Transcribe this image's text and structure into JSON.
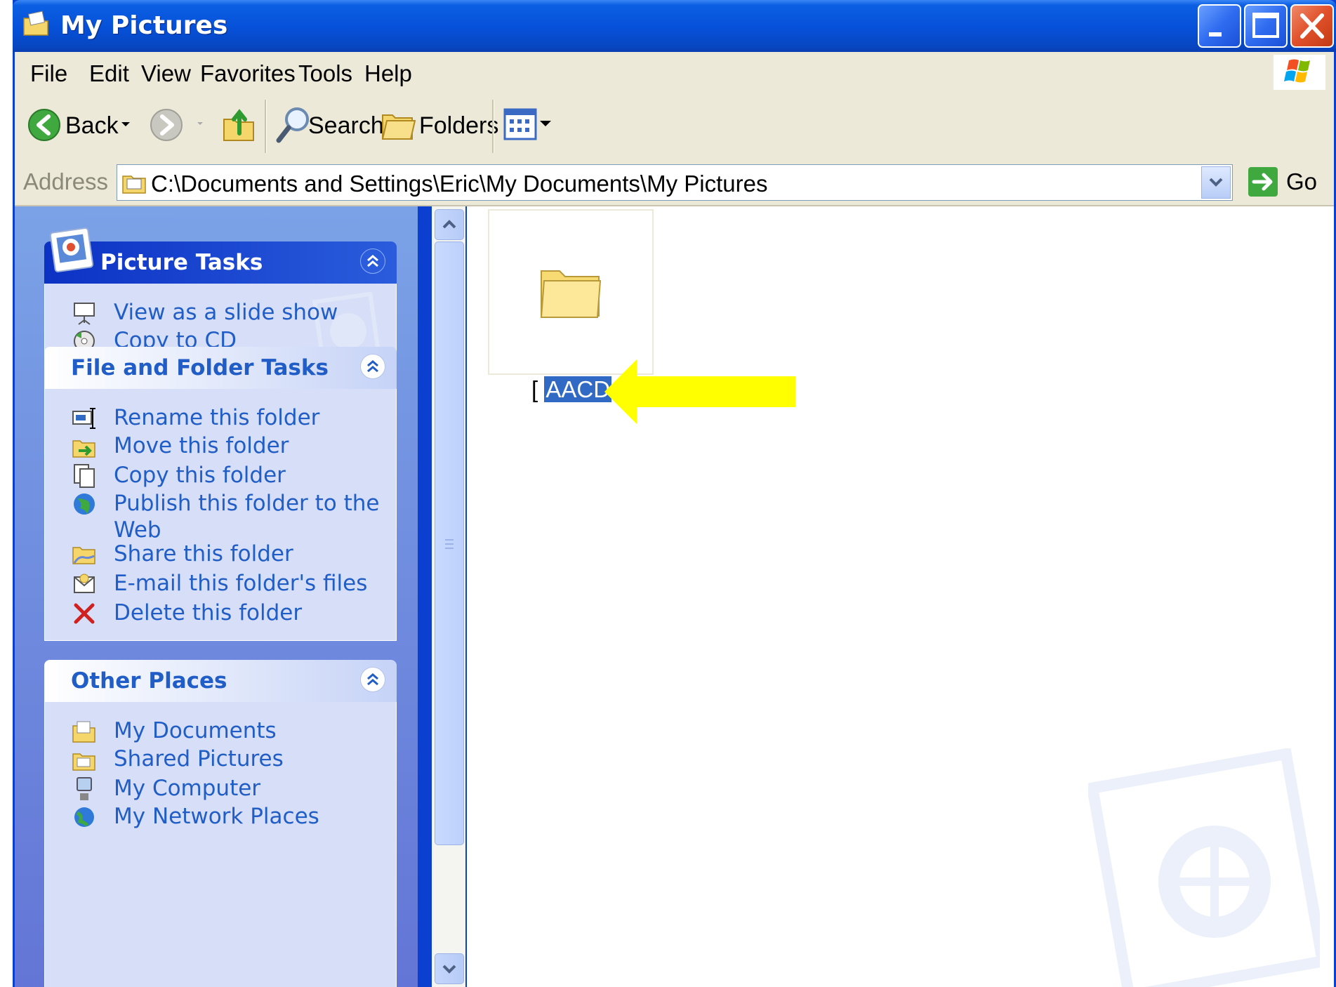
{
  "window": {
    "title": "My Pictures"
  },
  "menu": [
    "File",
    "Edit",
    "View",
    "Favorites",
    "Tools",
    "Help"
  ],
  "toolbar": {
    "back": "Back",
    "search": "Search",
    "folders": "Folders"
  },
  "address": {
    "label": "Address",
    "path": "C:\\Documents and Settings\\Eric\\My Documents\\My Pictures",
    "go": "Go"
  },
  "taskpane": {
    "picture_tasks": {
      "title": "Picture Tasks",
      "items": [
        {
          "label": "View as a slide show",
          "icon": "projector-icon"
        },
        {
          "label": "Copy to CD",
          "icon": "cd-copy-icon"
        }
      ]
    },
    "file_folder_tasks": {
      "title": "File and Folder Tasks",
      "items": [
        {
          "label": "Rename this folder",
          "icon": "rename-icon"
        },
        {
          "label": "Move this folder",
          "icon": "move-icon"
        },
        {
          "label": "Copy this folder",
          "icon": "copy-icon"
        },
        {
          "label": "Publish this folder to the Web",
          "icon": "globe-icon"
        },
        {
          "label": "Share this folder",
          "icon": "share-icon"
        },
        {
          "label": "E-mail this folder's files",
          "icon": "email-icon"
        },
        {
          "label": "Delete this folder",
          "icon": "delete-icon"
        }
      ]
    },
    "other_places": {
      "title": "Other Places",
      "items": [
        {
          "label": "My Documents",
          "icon": "my-documents-icon"
        },
        {
          "label": "Shared Pictures",
          "icon": "shared-pictures-icon"
        },
        {
          "label": "My Computer",
          "icon": "my-computer-icon"
        },
        {
          "label": "My Network Places",
          "icon": "network-places-icon"
        }
      ]
    }
  },
  "content": {
    "folder": {
      "name": "AACD",
      "state": "renaming"
    }
  },
  "colors": {
    "accent": "#215dc6",
    "selection": "#316ac5",
    "callout": "#ffff00"
  }
}
